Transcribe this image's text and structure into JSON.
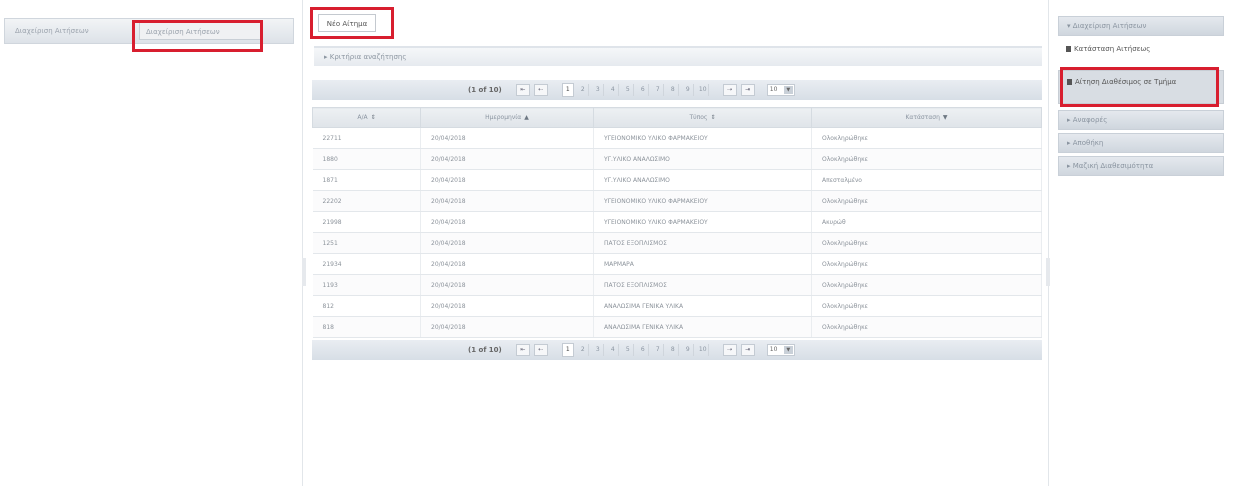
{
  "left": {
    "tabs": [
      {
        "label": "Διαχείριση Αιτήσεων"
      },
      {
        "label": "Διαχείριση Αιτήσεων"
      }
    ]
  },
  "center": {
    "new_request_label": "Νέο Αίτημα",
    "filter_label": "Κριτήρια αναζήτησης",
    "pager": {
      "count": "(1 of 10)",
      "first": "⇤",
      "prev": "⇠",
      "pages": [
        "1",
        "2",
        "3",
        "4",
        "5",
        "6",
        "7",
        "8",
        "9",
        "10"
      ],
      "next": "⇢",
      "last": "⇥",
      "page_size": "10"
    },
    "table": {
      "columns": [
        "Α/Α",
        "Ημερομηνία",
        "Τύπος",
        "Κατάσταση"
      ],
      "rows": [
        [
          "22711",
          "20/04/2018",
          "ΥΓΕΙΟΝΟΜΙΚΟ ΥΛΙΚΟ ΦΑΡΜΑΚΕΙΟΥ",
          "Ολοκληρώθηκε"
        ],
        [
          "1880",
          "20/04/2018",
          "ΥΓ.ΥΛΙΚΟ ΑΝΑΛΩΣΙΜΟ",
          "Ολοκληρώθηκε"
        ],
        [
          "1871",
          "20/04/2018",
          "ΥΓ.ΥΛΙΚΟ ΑΝΑΛΩΣΙΜΟ",
          "Απεσταλμένο"
        ],
        [
          "22202",
          "20/04/2018",
          "ΥΓΕΙΟΝΟΜΙΚΟ ΥΛΙΚΟ ΦΑΡΜΑΚΕΙΟΥ",
          "Ολοκληρώθηκε"
        ],
        [
          "21998",
          "20/04/2018",
          "ΥΓΕΙΟΝΟΜΙΚΟ ΥΛΙΚΟ ΦΑΡΜΑΚΕΙΟΥ",
          "Ακυρώθ"
        ],
        [
          "1251",
          "20/04/2018",
          "ΠΑΤΟΣ ΕΞΟΠΛΙΣΜΟΣ",
          "Ολοκληρώθηκε"
        ],
        [
          "21934",
          "20/04/2018",
          "ΜΑΡΜΑΡΑ",
          "Ολοκληρώθηκε"
        ],
        [
          "1193",
          "20/04/2018",
          "ΠΑΤΟΣ ΕΞΟΠΛΙΣΜΟΣ",
          "Ολοκληρώθηκε"
        ],
        [
          "812",
          "20/04/2018",
          "ΑΝΑΛΩΣΙΜΑ ΓΕΝΙΚΑ ΥΛΙΚΑ",
          "Ολοκληρώθηκε"
        ],
        [
          "818",
          "20/04/2018",
          "ΑΝΑΛΩΣΙΜΑ ΓΕΝΙΚΑ ΥΛΙΚΑ",
          "Ολοκληρώθηκε"
        ]
      ]
    }
  },
  "right": {
    "section1": "Διαχείριση Αιτήσεων",
    "items": [
      "Κατάσταση Αιτήσεως",
      "Αίτηση Διαθέσιμος σε Τμήμα"
    ],
    "sections": [
      "Αναφορές",
      "Αποθήκη",
      "Μαζική Διαθεσιμότητα"
    ]
  },
  "colors": {
    "highlight": "#d81e2f"
  }
}
